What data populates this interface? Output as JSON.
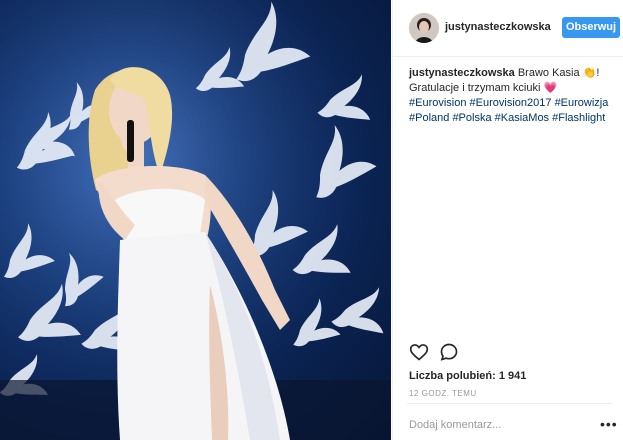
{
  "post": {
    "image_alt": "Kasia Moś on stage in white dress",
    "username": "justynasteczkowska",
    "follow_label": "Obserwuj",
    "caption_user": "justynasteczkowska",
    "caption_line1": " Brawo Kasia ",
    "clap_emoji": "👏",
    "caption_bang": "!",
    "caption_line2": "Gratulacje i trzymam kciuki ",
    "heart_emoji": "💗",
    "hashtags": [
      "#Eurovision",
      "#Eurovision2017",
      "#Eurowizja",
      "#Poland",
      "#Polska",
      "#KasiaMos",
      "#Flashlight"
    ],
    "likes_text": "Liczba polubień: 1 941",
    "time_text": "12 GODZ. TEMU",
    "comment_placeholder": "Dodaj komentarz...",
    "more_label": "•••"
  },
  "icons": {
    "like": "heart-outline-icon",
    "comment": "speech-bubble-icon"
  },
  "colors": {
    "follow_button": "#3897f0",
    "hashtag": "#003569",
    "stage_blue": "#163a78"
  }
}
